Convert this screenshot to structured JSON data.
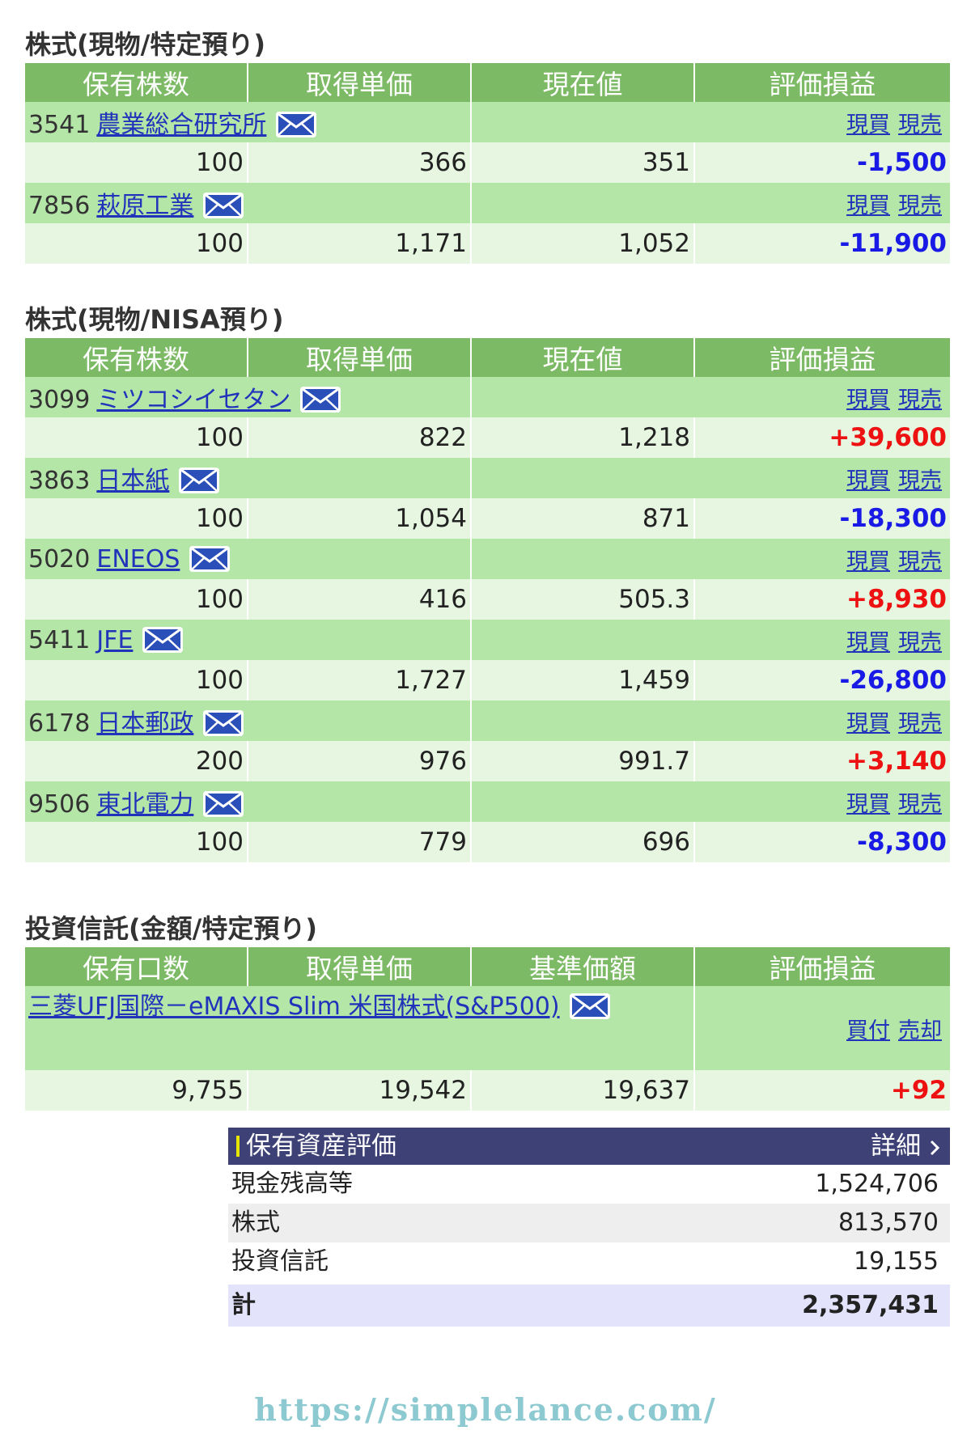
{
  "section1": {
    "title": "株式(現物/特定預り)",
    "headers": [
      "保有株数",
      "取得単価",
      "現在値",
      "評価損益"
    ],
    "rows": [
      {
        "code": "3541",
        "name": "農業総合研究所",
        "act1": "現買",
        "act2": "現売",
        "shares": "100",
        "cost": "366",
        "price": "351",
        "pl": "-1,500",
        "sign": "neg"
      },
      {
        "code": "7856",
        "name": "萩原工業",
        "act1": "現買",
        "act2": "現売",
        "shares": "100",
        "cost": "1,171",
        "price": "1,052",
        "pl": "-11,900",
        "sign": "neg"
      }
    ]
  },
  "section2": {
    "title": "株式(現物/NISA預り)",
    "headers": [
      "保有株数",
      "取得単価",
      "現在値",
      "評価損益"
    ],
    "rows": [
      {
        "code": "3099",
        "name": "ミツコシイセタン",
        "act1": "現買",
        "act2": "現売",
        "shares": "100",
        "cost": "822",
        "price": "1,218",
        "pl": "+39,600",
        "sign": "pos"
      },
      {
        "code": "3863",
        "name": "日本紙",
        "act1": "現買",
        "act2": "現売",
        "shares": "100",
        "cost": "1,054",
        "price": "871",
        "pl": "-18,300",
        "sign": "neg"
      },
      {
        "code": "5020",
        "name": "ENEOS",
        "act1": "現買",
        "act2": "現売",
        "shares": "100",
        "cost": "416",
        "price": "505.3",
        "pl": "+8,930",
        "sign": "pos"
      },
      {
        "code": "5411",
        "name": "JFE",
        "act1": "現買",
        "act2": "現売",
        "shares": "100",
        "cost": "1,727",
        "price": "1,459",
        "pl": "-26,800",
        "sign": "neg"
      },
      {
        "code": "6178",
        "name": "日本郵政",
        "act1": "現買",
        "act2": "現売",
        "shares": "200",
        "cost": "976",
        "price": "991.7",
        "pl": "+3,140",
        "sign": "pos"
      },
      {
        "code": "9506",
        "name": "東北電力",
        "act1": "現買",
        "act2": "現売",
        "shares": "100",
        "cost": "779",
        "price": "696",
        "pl": "-8,300",
        "sign": "neg"
      }
    ]
  },
  "section3": {
    "title": "投資信託(金額/特定預り)",
    "headers": [
      "保有口数",
      "取得単価",
      "基準価額",
      "評価損益"
    ],
    "fund": {
      "name": "三菱UFJ国際－eMAXIS Slim 米国株式(S&P500)",
      "act1": "買付",
      "act2": "売却",
      "units": "9,755",
      "cost": "19,542",
      "price": "19,637",
      "pl": "+92",
      "sign": "pos"
    }
  },
  "summary": {
    "title": "保有資産評価",
    "detail": "詳細",
    "rows": [
      {
        "label": "現金残高等",
        "value": "1,524,706"
      },
      {
        "label": "株式",
        "value": "813,570"
      },
      {
        "label": "投資信託",
        "value": "19,155"
      }
    ],
    "total": {
      "label": "計",
      "value": "2,357,431"
    }
  },
  "footer": {
    "url": "https://simplelance.com/"
  },
  "colors": {
    "header_green": "#7dba66",
    "name_row_green": "#b4e6a8",
    "value_row_green": "#e6f6e1",
    "loss_blue": "#1a1ae6",
    "gain_red": "#ee1111",
    "summary_navy": "#3d4176"
  }
}
